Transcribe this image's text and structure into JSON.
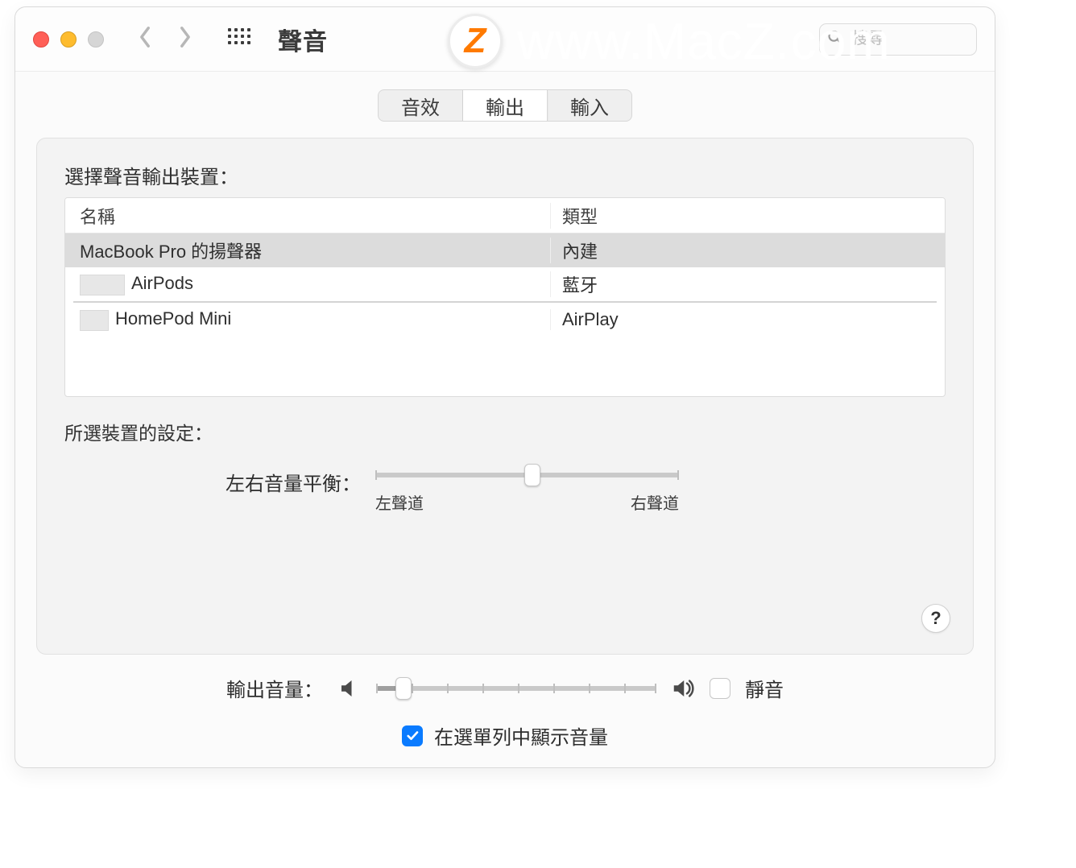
{
  "window": {
    "title": "聲音"
  },
  "toolbar": {
    "search_placeholder": "搜尋"
  },
  "tabs": {
    "effects": "音效",
    "output": "輸出",
    "input": "輸入",
    "active": "output"
  },
  "output_section": {
    "select_device_label": "選擇聲音輸出裝置：",
    "columns": {
      "name": "名稱",
      "type": "類型"
    },
    "devices": [
      {
        "name": "MacBook Pro 的揚聲器",
        "type": "內建",
        "selected": true,
        "indent": false
      },
      {
        "name": "AirPods",
        "type": "藍牙",
        "selected": false,
        "indent": true
      },
      {
        "name": "HomePod Mini",
        "type": "AirPlay",
        "selected": false,
        "indent": true
      }
    ],
    "settings_label": "所選裝置的設定：",
    "balance": {
      "label": "左右音量平衡：",
      "left_label": "左聲道",
      "right_label": "右聲道",
      "value_percent": 50
    }
  },
  "footer": {
    "output_volume_label": "輸出音量：",
    "mute_label": "靜音",
    "mute_checked": false,
    "volume_percent": 8,
    "show_in_menubar_label": "在選單列中顯示音量",
    "show_in_menubar_checked": true
  },
  "help_button": "?",
  "watermark": {
    "badge": "Z",
    "text": "www.MacZ.com"
  }
}
